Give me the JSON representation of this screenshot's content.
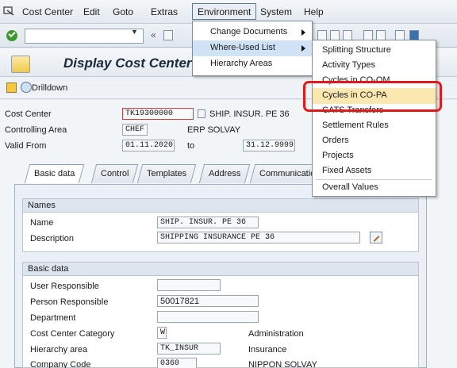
{
  "menubar": {
    "items": [
      "Cost Center",
      "Edit",
      "Goto",
      "Extras",
      "Environment",
      "System",
      "Help"
    ]
  },
  "title": "Display Cost Center: I",
  "app_toolbar": {
    "drilldown_label": "Drilldown"
  },
  "header": {
    "cost_center_label": "Cost Center",
    "cost_center_value": "TK19300000",
    "cost_center_name": "SHIP. INSUR. PE 36",
    "controlling_area_label": "Controlling Area",
    "controlling_area_value": "CHEF",
    "controlling_area_name": "ERP SOLVAY",
    "valid_from_label": "Valid From",
    "valid_from_value": "01.11.2020",
    "to_label": "to",
    "valid_to_value": "31.12.9999"
  },
  "tabs": [
    "Basic data",
    "Control",
    "Templates",
    "Address",
    "Communication"
  ],
  "names_group": {
    "title": "Names",
    "name_label": "Name",
    "name_value": "SHIP. INSUR. PE 36",
    "description_label": "Description",
    "description_value": "SHIPPING INSURANCE PE 36"
  },
  "basic_group": {
    "title": "Basic data",
    "user_responsible_label": "User Responsible",
    "user_responsible_value": "",
    "person_responsible_label": "Person Responsible",
    "person_responsible_value": "50017821",
    "department_label": "Department",
    "department_value": "",
    "category_label": "Cost Center Category",
    "category_value": "W",
    "category_text": "Administration",
    "hierarchy_label": "Hierarchy area",
    "hierarchy_value": "TK_INSUR",
    "hierarchy_text": "Insurance",
    "company_label": "Company Code",
    "company_value": "0360",
    "company_text": "NIPPON SOLVAY"
  },
  "environment_menu": {
    "items": [
      "Change Documents",
      "Where-Used List",
      "Hierarchy Areas"
    ]
  },
  "where_used_submenu": {
    "items": [
      "Splitting Structure",
      "Activity Types",
      "Cycles in CO-OM",
      "Cycles in CO-PA",
      "CATS Transfers",
      "Settlement Rules",
      "Orders",
      "Projects",
      "Fixed Assets",
      "Overall Values"
    ]
  },
  "colors": {
    "highlight_ring": "#e01a1a",
    "submenu_highlight": "#fbe7b0"
  }
}
